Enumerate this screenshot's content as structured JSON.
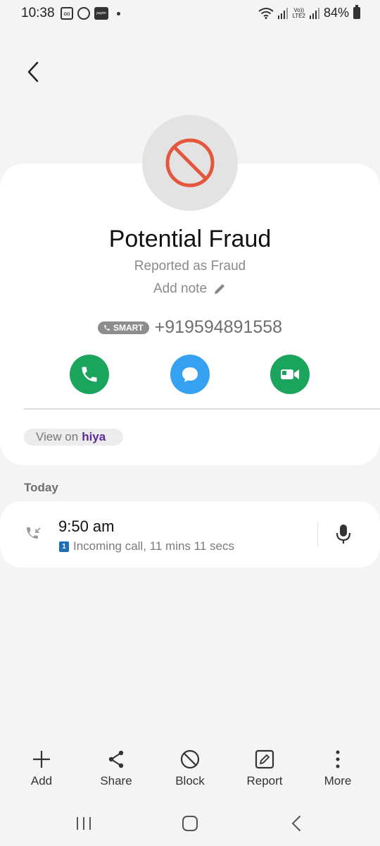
{
  "status_bar": {
    "time": "10:38",
    "battery": "84%",
    "lte_top": "Vo))",
    "lte_bottom": "LTE2",
    "paytm": "paytm"
  },
  "contact": {
    "name": "Potential Fraud",
    "reported_label": "Reported as Fraud",
    "add_note_label": "Add note",
    "smart_badge": "SMART",
    "phone_number": "+919594891558"
  },
  "hiya": {
    "view_on_label": "View on",
    "brand": "hiya"
  },
  "history": {
    "section_label": "Today",
    "items": [
      {
        "time": "9:50 am",
        "sim": "1",
        "detail": "Incoming call, 11 mins 11 secs"
      }
    ]
  },
  "toolbar": {
    "add": "Add",
    "share": "Share",
    "block": "Block",
    "report": "Report",
    "more": "More"
  },
  "colors": {
    "call_green": "#1aa45c",
    "message_blue": "#35a1f0",
    "block_red": "#e3573d",
    "hiya_purple": "#5c2d91"
  },
  "icons": {
    "back": "chevron-left-icon",
    "avatar": "block-circle-icon",
    "note": "pencil-icon",
    "call": "phone-icon",
    "message": "chat-bubble-icon",
    "video": "video-camera-icon",
    "incoming": "incoming-call-icon",
    "recording": "microphone-icon"
  }
}
